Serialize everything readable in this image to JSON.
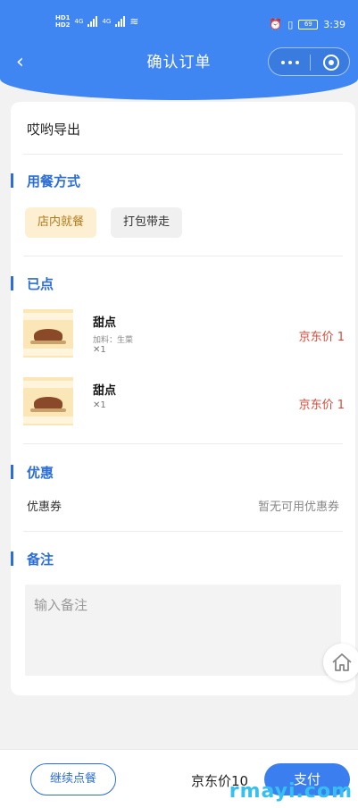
{
  "status_bar": {
    "network_left": "4G",
    "network_right": "4G",
    "battery": "69",
    "time": "3:39"
  },
  "header": {
    "title": "确认订单"
  },
  "store": {
    "name": "哎哟导出"
  },
  "dining": {
    "section_title": "用餐方式",
    "options": [
      "店内就餐",
      "打包带走"
    ],
    "selected": "店内就餐"
  },
  "ordered": {
    "section_title": "已点",
    "items": [
      {
        "name": "甜点",
        "addon": "加料：生菜",
        "qty": "✕1",
        "price": "京东价 1"
      },
      {
        "name": "甜点",
        "addon": "",
        "qty": "✕1",
        "price": "京东价 1"
      }
    ]
  },
  "discount": {
    "section_title": "优惠",
    "coupon_label": "优惠券",
    "coupon_value": "暂无可用优惠券"
  },
  "remark": {
    "section_title": "备注",
    "placeholder": "输入备注",
    "value": ""
  },
  "footer": {
    "continue_label": "继续点餐",
    "total": "京东价10",
    "pay_label": "支付"
  },
  "watermark": "rmayi.com",
  "colors": {
    "primary": "#3f86f2",
    "accent_blue": "#2c6ed6",
    "price_red": "#d64a3a",
    "selected_chip_bg": "#fdf0d2"
  }
}
